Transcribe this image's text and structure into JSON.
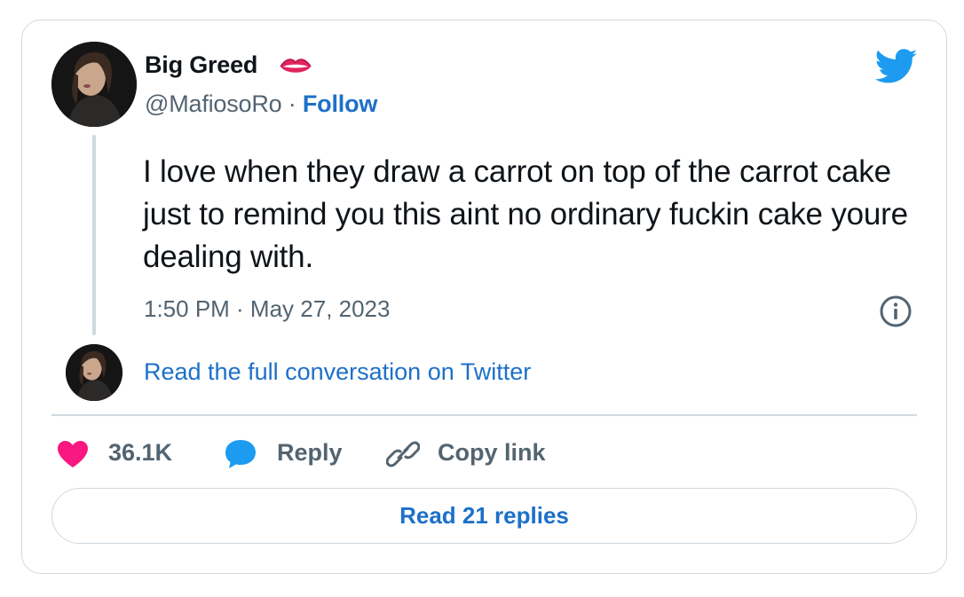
{
  "author": {
    "name": "Big Greed",
    "name_emoji_icon": "lips-icon",
    "handle": "@MafiosoRo",
    "separator": "·",
    "follow_label": "Follow"
  },
  "tweet": {
    "text": "I love when they draw a carrot on top of the carrot cake just to remind you this aint no ordinary fuckin cake youre dealing with.",
    "timestamp": "1:50 PM · May 27, 2023"
  },
  "conversation_link": "Read the full conversation on Twitter",
  "actions": {
    "like_count": "36.1K",
    "reply_label": "Reply",
    "copy_link_label": "Copy link"
  },
  "read_replies_label": "Read 21 replies",
  "colors": {
    "accent_blue": "#1d70c8",
    "twitter_blue": "#1d9bf0",
    "heart_pink": "#f91880",
    "muted_text": "#536471",
    "border": "#cfd9de"
  },
  "icons": {
    "brand": "twitter-bird-icon",
    "info": "info-icon",
    "like": "heart-icon",
    "reply": "speech-bubble-icon",
    "copy": "link-icon"
  }
}
